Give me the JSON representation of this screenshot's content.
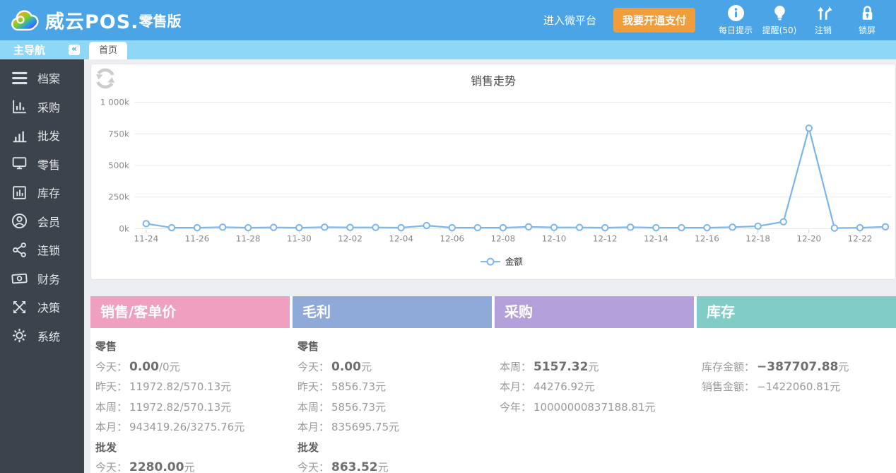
{
  "topbar": {
    "brand": "威云POS.",
    "brand_suffix": "零售版",
    "wechat_link": "进入微平台",
    "pay_button": "我要开通支付",
    "actions": [
      {
        "label": "每日提示",
        "icon": "info-icon"
      },
      {
        "label": "提醒(50)",
        "icon": "bulb-icon"
      },
      {
        "label": "注销",
        "icon": "logout-icon"
      },
      {
        "label": "锁屏",
        "icon": "lock-icon"
      }
    ],
    "colors": {
      "bar": "#4aa4e6",
      "pay_button": "#f29d3c"
    }
  },
  "subbar": {
    "nav_title": "主导航",
    "collapse_glyph": "«",
    "tab": "首页"
  },
  "sidebar": {
    "items": [
      {
        "label": "档案",
        "icon": "files-icon"
      },
      {
        "label": "采购",
        "icon": "purchase-chart-icon"
      },
      {
        "label": "批发",
        "icon": "wholesale-chart-icon"
      },
      {
        "label": "零售",
        "icon": "retail-monitor-icon"
      },
      {
        "label": "库存",
        "icon": "inventory-box-icon"
      },
      {
        "label": "会员",
        "icon": "member-icon"
      },
      {
        "label": "连锁",
        "icon": "chain-share-icon"
      },
      {
        "label": "财务",
        "icon": "finance-money-icon"
      },
      {
        "label": "决策",
        "icon": "decision-arrows-icon"
      },
      {
        "label": "系统",
        "icon": "system-gear-icon"
      }
    ]
  },
  "chart_data": {
    "type": "line",
    "title": "销售走势",
    "x": [
      "11-24",
      "11-25",
      "11-26",
      "11-27",
      "11-28",
      "11-29",
      "11-30",
      "12-01",
      "12-02",
      "12-03",
      "12-04",
      "12-05",
      "12-06",
      "12-07",
      "12-08",
      "12-09",
      "12-10",
      "12-11",
      "12-12",
      "12-13",
      "12-14",
      "12-15",
      "12-16",
      "12-17",
      "12-18",
      "12-19",
      "12-20",
      "12-21",
      "12-22",
      "12-23"
    ],
    "series": [
      {
        "name": "金额",
        "color": "#7cb5ec",
        "values_k": [
          40,
          8,
          8,
          12,
          8,
          10,
          8,
          12,
          10,
          10,
          8,
          25,
          8,
          8,
          8,
          15,
          10,
          10,
          8,
          12,
          8,
          8,
          8,
          12,
          20,
          55,
          795,
          5,
          8,
          15
        ]
      }
    ],
    "ylim_k": [
      0,
      1000
    ],
    "ytick_values_k": [
      0,
      250,
      500,
      750,
      1000
    ],
    "ytick_labels": [
      "0k",
      "250k",
      "500k",
      "750k",
      "1 000k"
    ],
    "x_label_every": 2,
    "grid": true,
    "legend_position": "bottom"
  },
  "cards": [
    {
      "title": "销售/客单价",
      "color": "#ef9fbf",
      "sections": [
        {
          "heading": "零售",
          "rows": [
            {
              "label": "今天：",
              "strong": "0.00",
              "rest": "/0元"
            },
            {
              "label": "昨天：",
              "strong": "",
              "rest": "11972.82/570.13元"
            },
            {
              "label": "本周：",
              "strong": "",
              "rest": "11972.82/570.13元"
            },
            {
              "label": "本月：",
              "strong": "",
              "rest": "943419.26/3275.76元"
            }
          ]
        },
        {
          "heading": "批发",
          "rows": [
            {
              "label": "今天：",
              "strong": "2280.00",
              "rest": "元"
            }
          ]
        }
      ]
    },
    {
      "title": "毛利",
      "color": "#8fa9d9",
      "sections": [
        {
          "heading": "零售",
          "rows": [
            {
              "label": "今天：",
              "strong": "0.00",
              "rest": "元"
            },
            {
              "label": "昨天：",
              "strong": "",
              "rest": "5856.73元"
            },
            {
              "label": "本周：",
              "strong": "",
              "rest": "5856.73元"
            },
            {
              "label": "本月：",
              "strong": "",
              "rest": "835695.75元"
            }
          ]
        },
        {
          "heading": "批发",
          "rows": [
            {
              "label": "今天：",
              "strong": "863.52",
              "rest": "元"
            }
          ]
        }
      ]
    },
    {
      "title": "采购",
      "color": "#b4a1dc",
      "sections": [
        {
          "heading": "",
          "rows": [
            {
              "label": "本周：",
              "strong": "5157.32",
              "rest": "元"
            },
            {
              "label": "本月：",
              "strong": "",
              "rest": "44276.92元"
            },
            {
              "label": "今年：",
              "strong": "",
              "rest": "10000000837188.81元"
            }
          ]
        }
      ]
    },
    {
      "title": "库存",
      "color": "#81ccc6",
      "sections": [
        {
          "heading": "",
          "rows": [
            {
              "label": "库存金额：",
              "strong": "−387707.88",
              "rest": "元"
            },
            {
              "label": "销售金额：",
              "strong": "",
              "rest": "−1422060.81元"
            }
          ]
        }
      ]
    }
  ]
}
